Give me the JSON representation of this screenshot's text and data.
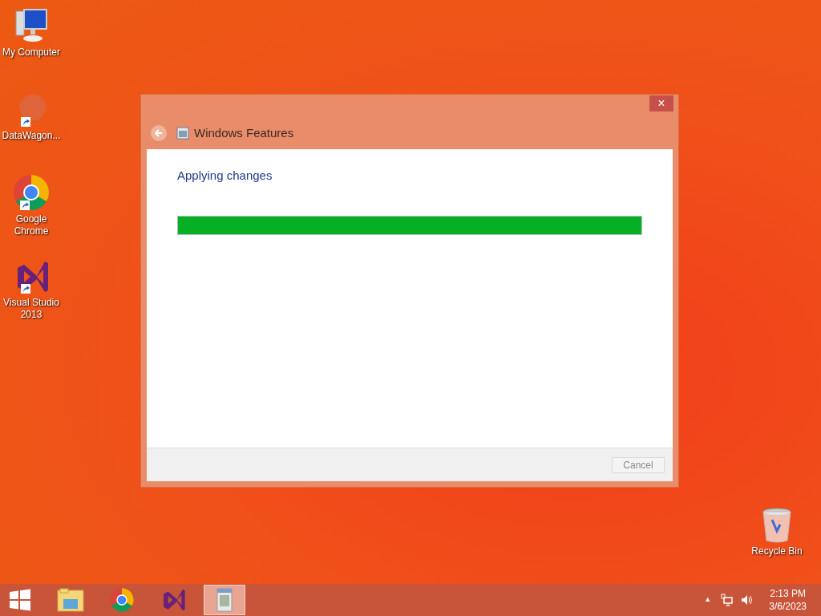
{
  "desktop_icons": [
    {
      "kind": "computer",
      "label": "My Computer",
      "shortcut": false
    },
    {
      "kind": "app",
      "label": "DataWagon...",
      "shortcut": true
    },
    {
      "kind": "chrome",
      "label": "Google Chrome",
      "shortcut": true
    },
    {
      "kind": "vs",
      "label": "Visual Studio 2013",
      "shortcut": true
    },
    {
      "kind": "bin",
      "label": "Recycle Bin",
      "shortcut": false
    }
  ],
  "window": {
    "title": "Windows Features",
    "heading": "Applying changes",
    "progress": {
      "level": 1.0
    },
    "cancel": {
      "label": "Cancel",
      "disabled": true
    },
    "close": "×"
  },
  "taskbar": {
    "items": [
      {
        "kind": "explorer",
        "selected": false
      },
      {
        "kind": "chrome",
        "selected": false
      },
      {
        "kind": "vs",
        "selected": false
      },
      {
        "kind": "features",
        "selected": true
      }
    ],
    "tray_arrow": "▲",
    "time": "2:13 PM",
    "date": "3/6/2023"
  }
}
